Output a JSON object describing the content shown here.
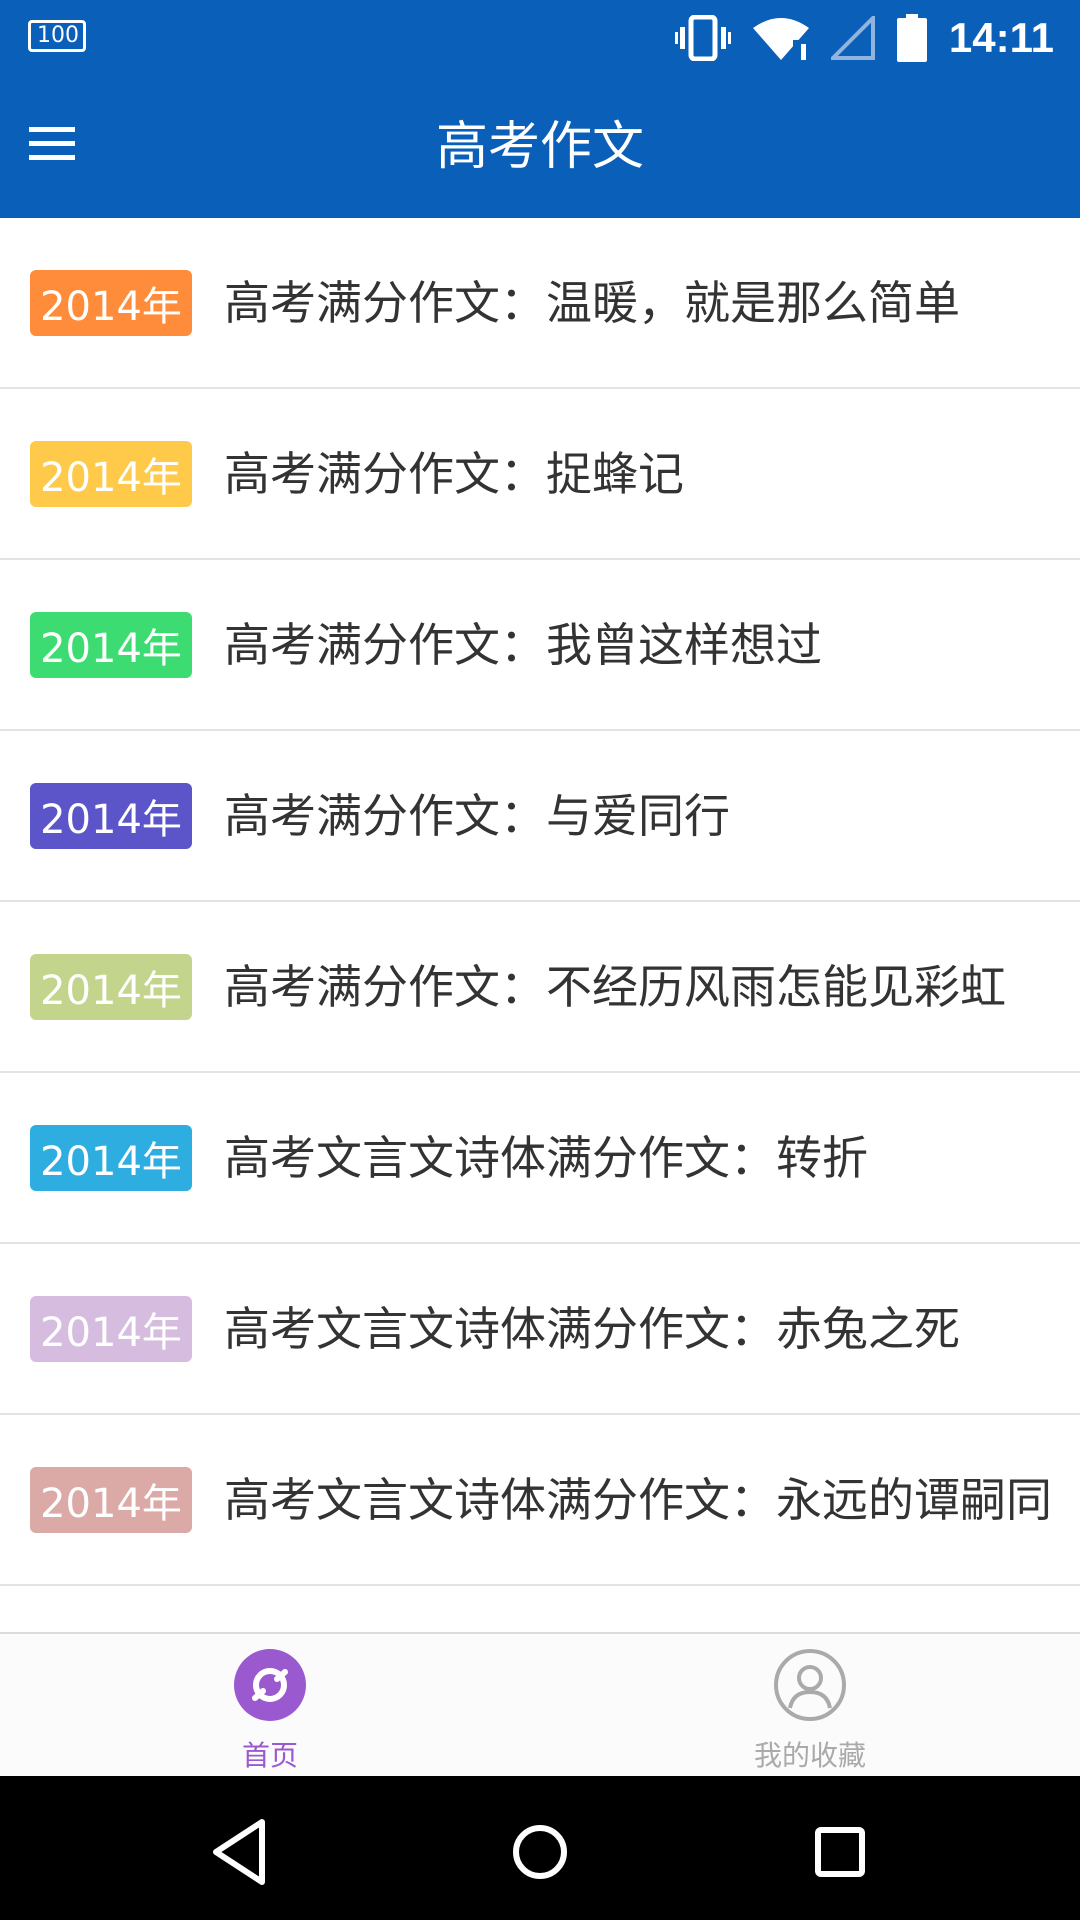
{
  "status_bar": {
    "battery_percent": "100",
    "time": "14:11"
  },
  "app_bar": {
    "title": "高考作文"
  },
  "articles": [
    {
      "year": "2014年",
      "title": "高考满分作文：温暖，就是那么简单",
      "badge_color": "#ff8c3a"
    },
    {
      "year": "2014年",
      "title": "高考满分作文：捉蜂记",
      "badge_color": "#ffc94a"
    },
    {
      "year": "2014年",
      "title": "高考满分作文：我曾这样想过",
      "badge_color": "#3ddc72"
    },
    {
      "year": "2014年",
      "title": "高考满分作文：与爱同行",
      "badge_color": "#5b55c9"
    },
    {
      "year": "2014年",
      "title": "高考满分作文：不经历风雨怎能见彩虹",
      "badge_color": "#c3d48c"
    },
    {
      "year": "2014年",
      "title": "高考文言文诗体满分作文：转折",
      "badge_color": "#2eaee0"
    },
    {
      "year": "2014年",
      "title": "高考文言文诗体满分作文：赤兔之死",
      "badge_color": "#d6bde0"
    },
    {
      "year": "2014年",
      "title": "高考文言文诗体满分作文：永远的谭嗣同",
      "badge_color": "#dba9a6"
    }
  ],
  "bottom_nav": {
    "home_label": "首页",
    "favorites_label": "我的收藏",
    "home_color": "#9b59d0",
    "favorites_color": "#aaaaaa"
  },
  "colors": {
    "primary": "#0a5fb9"
  }
}
